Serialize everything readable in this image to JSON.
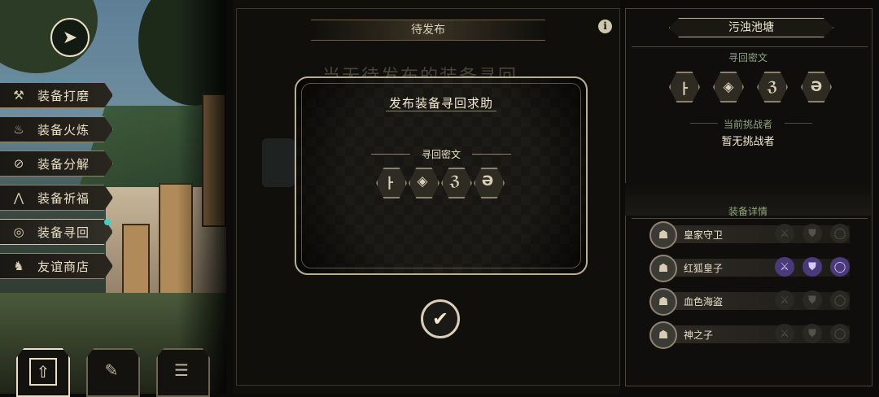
{
  "left_menu": {
    "items": [
      {
        "label": "装备打磨",
        "icon": "hammer-icon"
      },
      {
        "label": "装备火炼",
        "icon": "flame-icon"
      },
      {
        "label": "装备分解",
        "icon": "dismantle-icon"
      },
      {
        "label": "装备祈福",
        "icon": "pray-icon"
      },
      {
        "label": "装备寻回",
        "icon": "retrieve-icon"
      },
      {
        "label": "友谊商店",
        "icon": "fox-icon"
      }
    ],
    "active_index": 4
  },
  "bottom_tabs": [
    {
      "icon": "upload-icon",
      "active": true
    },
    {
      "icon": "feather-icon",
      "active": false
    },
    {
      "icon": "list-icon",
      "active": false
    }
  ],
  "center": {
    "tab_label": "待发布",
    "background_text": "当无待发布的装备寻回"
  },
  "dialog": {
    "title": "发布装备寻回求助",
    "subtitle": "寻回密文",
    "runes": [
      "ㅏ",
      "◈",
      "ℨ",
      "Ә"
    ]
  },
  "right": {
    "map_title": "污浊池塘",
    "cipher_label": "寻回密文",
    "runes": [
      "ㅏ",
      "◈",
      "ℨ",
      "Ә"
    ],
    "challenger_label": "当前挑战者",
    "challenger_value": "暂无挑战者",
    "equip_label": "装备详情",
    "equipment": [
      {
        "name": "皇家守卫",
        "owned": [
          false,
          false,
          false
        ]
      },
      {
        "name": "红狐皇子",
        "owned": [
          true,
          true,
          true
        ]
      },
      {
        "name": "血色海盗",
        "owned": [
          false,
          false,
          false
        ]
      },
      {
        "name": "神之子",
        "owned": [
          false,
          false,
          false
        ]
      }
    ]
  },
  "colors": {
    "accent_gold": "#d9cfb5",
    "owned_purple": "#4a3a7a",
    "label_green": "#8fa57b",
    "notify_cyan": "#3fd1c9"
  }
}
